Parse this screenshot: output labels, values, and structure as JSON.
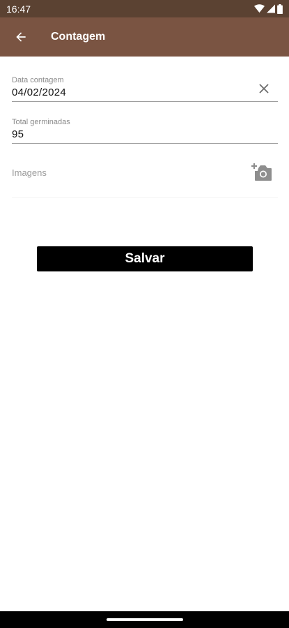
{
  "status_bar": {
    "time": "16:47",
    "icons": [
      "wifi-icon",
      "signal-icon",
      "battery-icon"
    ]
  },
  "app_bar": {
    "title": "Contagem",
    "back_icon": "arrow-left-icon"
  },
  "form": {
    "date_field": {
      "label": "Data contagem",
      "value": "04/02/2024",
      "clear_icon": "close-icon"
    },
    "total_field": {
      "label": "Total germinadas",
      "value": "95"
    },
    "images": {
      "label": "Imagens",
      "icon": "add-photo-icon"
    }
  },
  "actions": {
    "save_label": "Salvar"
  },
  "colors": {
    "status_bar": "#5b4232",
    "app_bar": "#7a5442",
    "button": "#000000",
    "nav_bar": "#000000"
  }
}
